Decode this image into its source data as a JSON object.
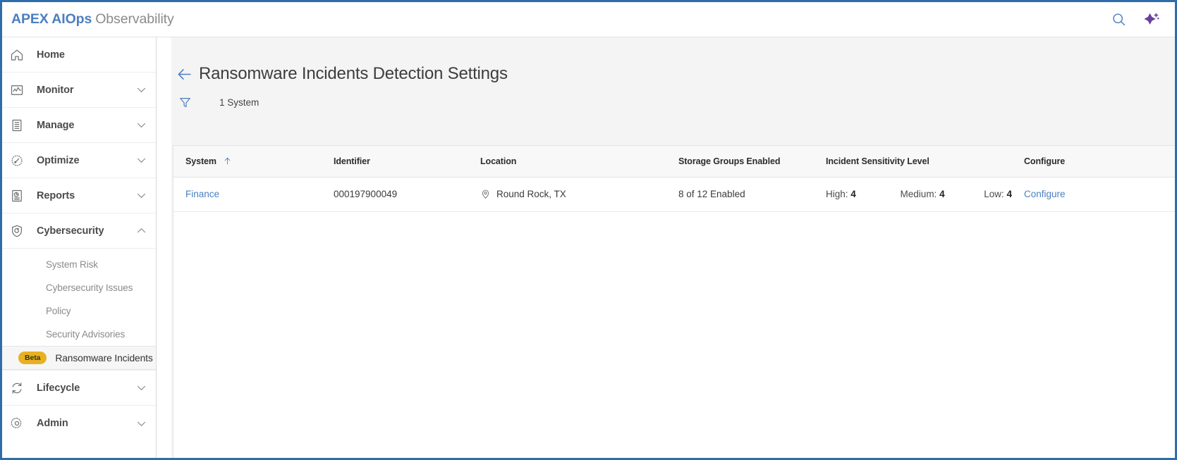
{
  "window": {
    "border_color": "#2e6da9"
  },
  "header": {
    "brand_primary": "APEX AIOps",
    "brand_secondary": "Observability",
    "brand_primary_color": "#4a7fc1",
    "brand_secondary_color": "#8b8b8b",
    "search_icon": "search-icon",
    "assistant_icon": "sparkle-icon",
    "assistant_color": "#6b3fa0"
  },
  "sidebar": {
    "items": [
      {
        "label": "Home",
        "icon": "home-icon",
        "expandable": false
      },
      {
        "label": "Monitor",
        "icon": "monitor-chart-icon",
        "expandable": true,
        "expanded": false
      },
      {
        "label": "Manage",
        "icon": "server-list-icon",
        "expandable": true,
        "expanded": false
      },
      {
        "label": "Optimize",
        "icon": "gauge-icon",
        "expandable": true,
        "expanded": false
      },
      {
        "label": "Reports",
        "icon": "report-document-icon",
        "expandable": true,
        "expanded": false
      },
      {
        "label": "Cybersecurity",
        "icon": "shield-icon",
        "expandable": true,
        "expanded": true
      }
    ],
    "cyber_subitems": [
      {
        "label": "System Risk",
        "selected": false,
        "badge": null
      },
      {
        "label": "Cybersecurity Issues",
        "selected": false,
        "badge": null
      },
      {
        "label": "Policy",
        "selected": false,
        "badge": null
      },
      {
        "label": "Security Advisories",
        "selected": false,
        "badge": null
      },
      {
        "label": "Ransomware Incidents",
        "selected": true,
        "badge": "Beta"
      }
    ],
    "bottom_items": [
      {
        "label": "Lifecycle",
        "icon": "refresh-cycle-icon",
        "expandable": true,
        "expanded": false
      },
      {
        "label": "Admin",
        "icon": "gear-icon",
        "expandable": true,
        "expanded": false
      }
    ],
    "badge_color": "#e8b122"
  },
  "main": {
    "back_icon": "back-arrow-icon",
    "page_title": "Ransomware Incidents Detection Settings",
    "filter_icon": "filter-funnel-icon",
    "system_count": "1 System"
  },
  "table": {
    "columns": [
      {
        "label": "System",
        "sorted": true,
        "sort_dir": "asc"
      },
      {
        "label": "Identifier",
        "sorted": false
      },
      {
        "label": "Location",
        "sorted": false
      },
      {
        "label": "Storage Groups Enabled",
        "sorted": false
      },
      {
        "label": "Incident Sensitivity Level",
        "sorted": false
      },
      {
        "label": "Configure",
        "sorted": false
      }
    ],
    "rows": [
      {
        "system": "Finance",
        "identifier": "000197900049",
        "location": "Round Rock, TX",
        "location_icon": "location-pin-icon",
        "storage_groups": "8 of 12 Enabled",
        "sensitivity": {
          "high_label": "High:",
          "high_value": "4",
          "medium_label": "Medium:",
          "medium_value": "4",
          "low_label": "Low:",
          "low_value": "4"
        },
        "configure": "Configure"
      }
    ]
  }
}
